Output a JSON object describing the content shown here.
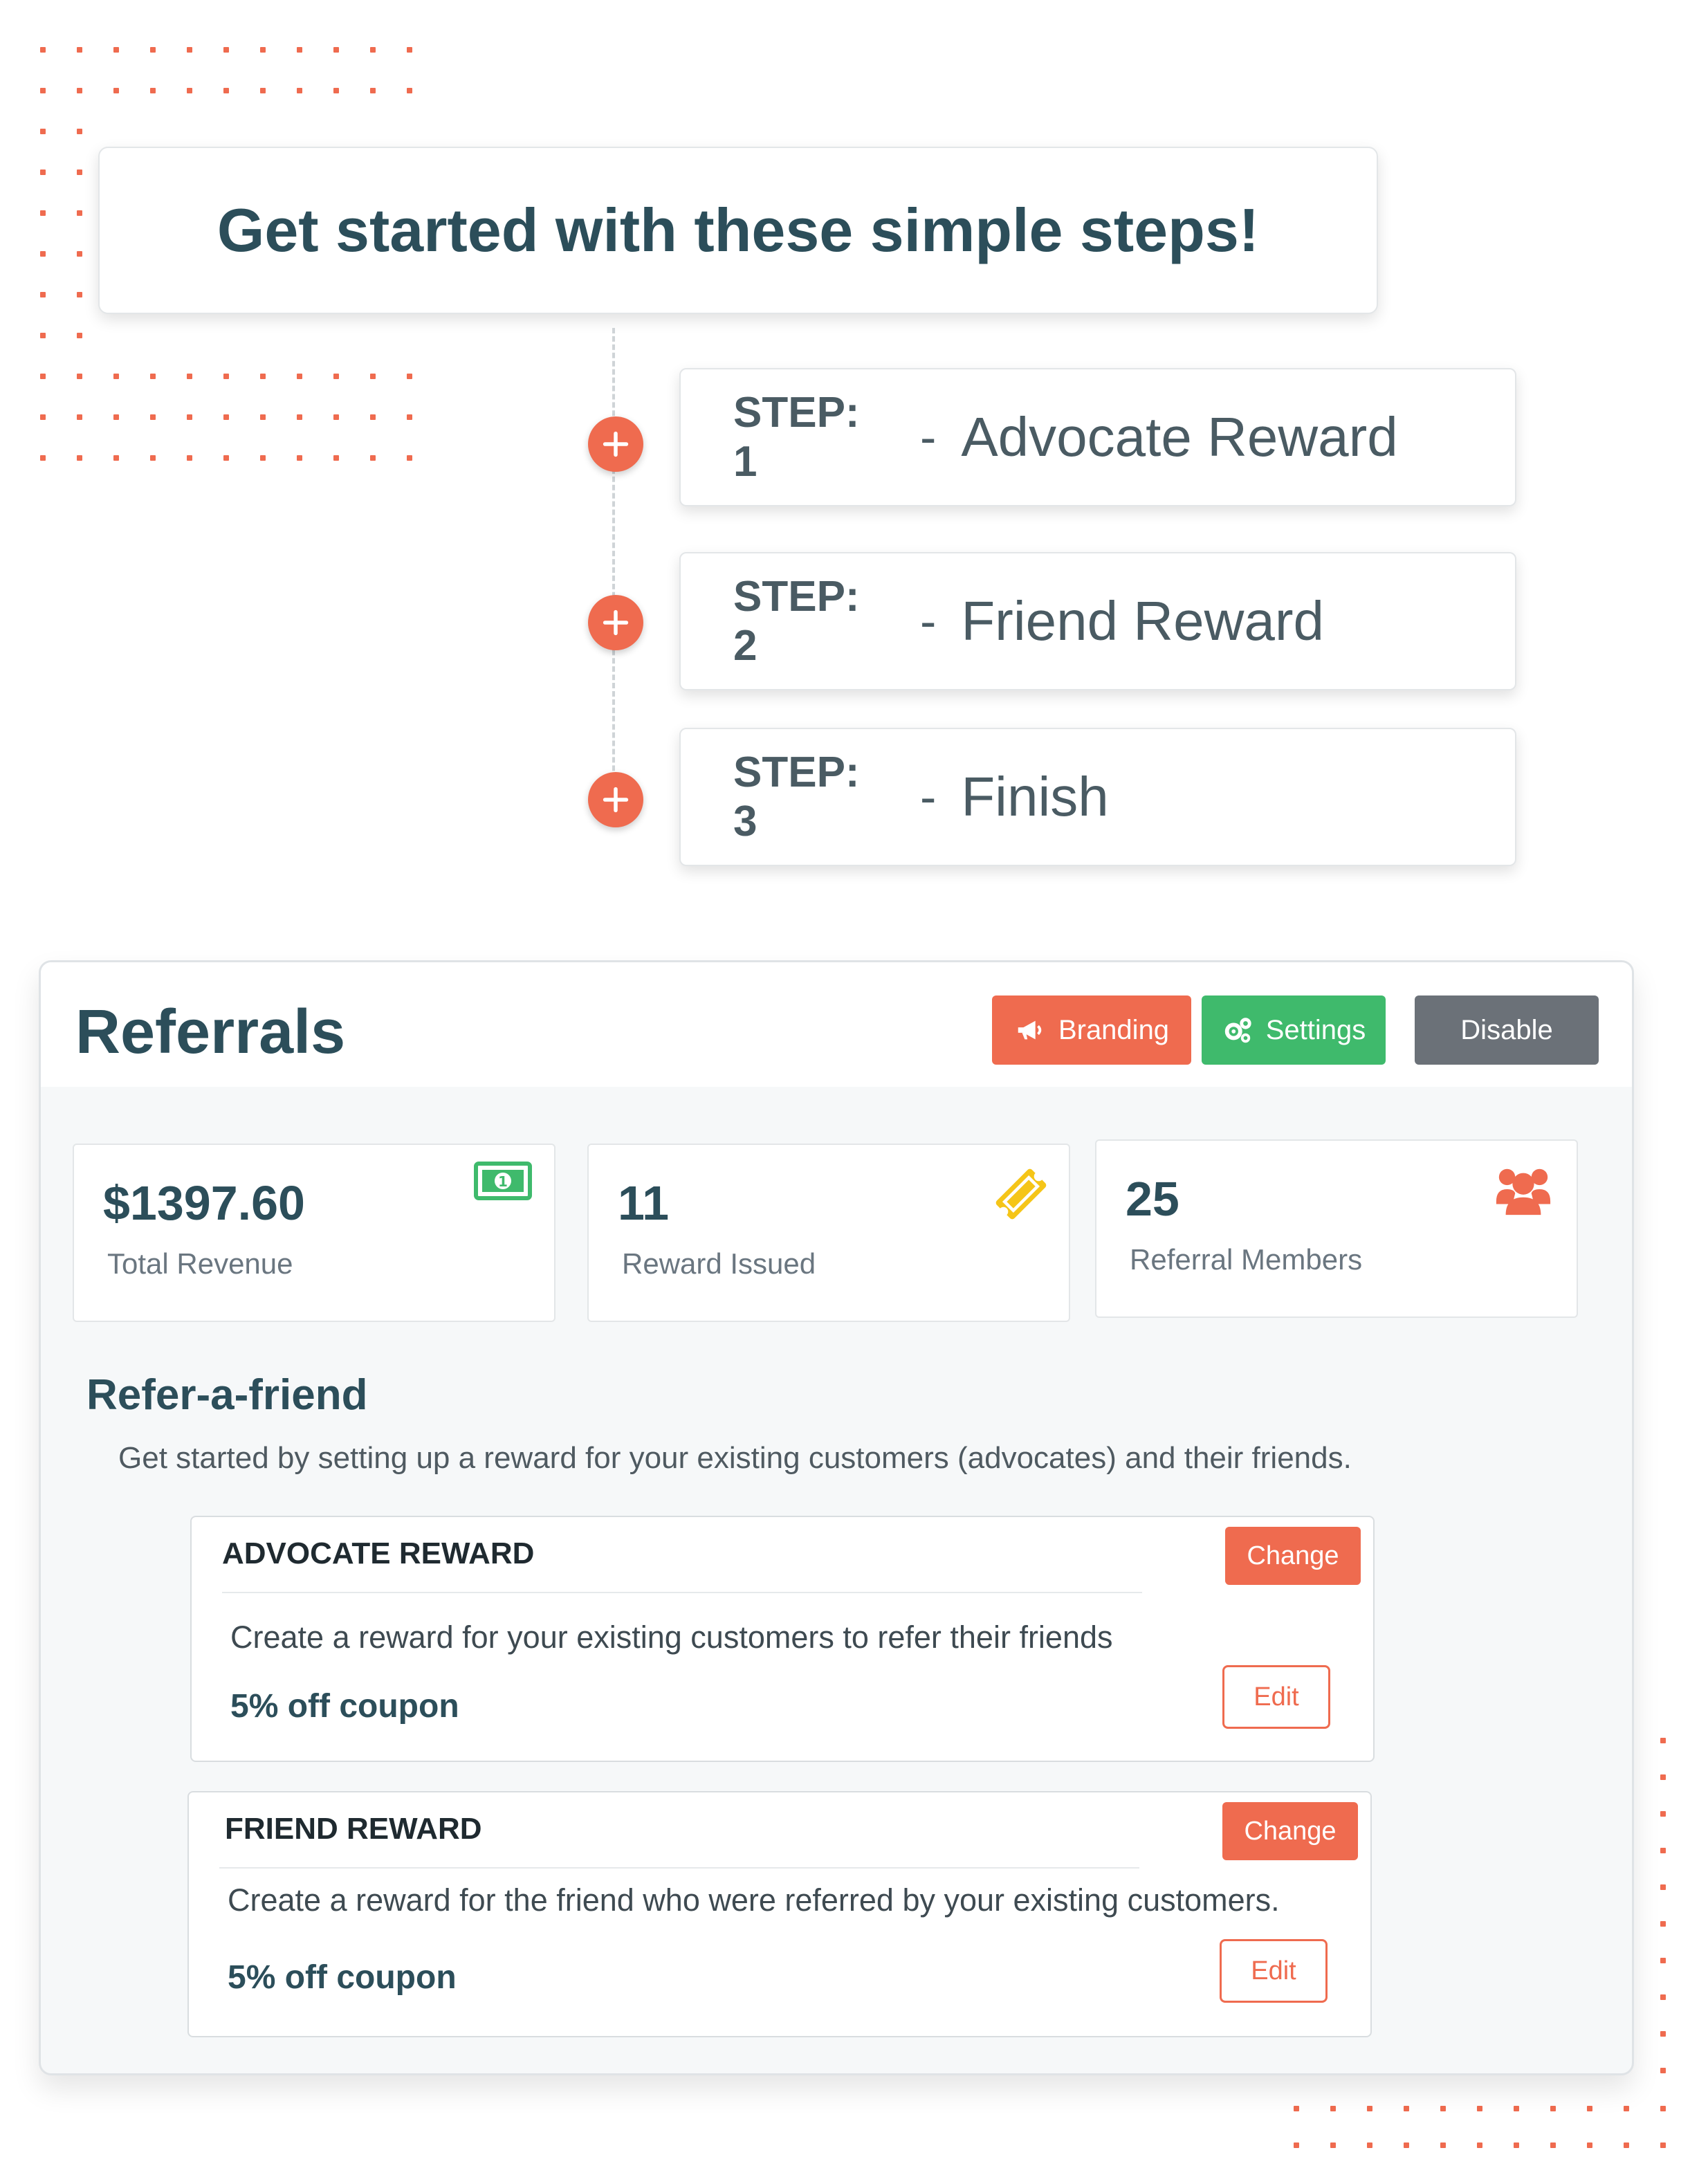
{
  "header": {
    "title": "Get started with these simple steps!"
  },
  "steps": [
    {
      "label": "STEP: 1",
      "dash": "-",
      "name": "Advocate Reward"
    },
    {
      "label": "STEP: 2",
      "dash": "-",
      "name": "Friend Reward"
    },
    {
      "label": "STEP: 3",
      "dash": "-",
      "name": "Finish"
    }
  ],
  "referrals": {
    "title": "Referrals",
    "buttons": {
      "branding": "Branding",
      "settings": "Settings",
      "disable": "Disable"
    },
    "stats": [
      {
        "value": "$1397.60",
        "label": "Total Revenue",
        "icon": "money-icon"
      },
      {
        "value": "11",
        "label": "Reward Issued",
        "icon": "ticket-icon"
      },
      {
        "value": "25",
        "label": "Referral Members",
        "icon": "users-icon"
      }
    ],
    "refer_a_friend": {
      "title": "Refer-a-friend",
      "description": "Get started by setting up a reward for your existing customers (advocates) and their friends."
    },
    "rewards": [
      {
        "heading": "ADVOCATE REWARD",
        "description": "Create a reward for your existing customers to refer their friends",
        "value": "5% off coupon",
        "change_label": "Change",
        "edit_label": "Edit"
      },
      {
        "heading": "FRIEND REWARD",
        "description": "Create a reward for the friend who were referred by your existing customers.",
        "value": "5% off coupon",
        "change_label": "Change",
        "edit_label": "Edit"
      }
    ]
  },
  "colors": {
    "accent": "#ef6b4f",
    "success": "#3fba6c",
    "muted": "#6b7178",
    "heading": "#2c4e5a",
    "warning": "#f5c518"
  }
}
